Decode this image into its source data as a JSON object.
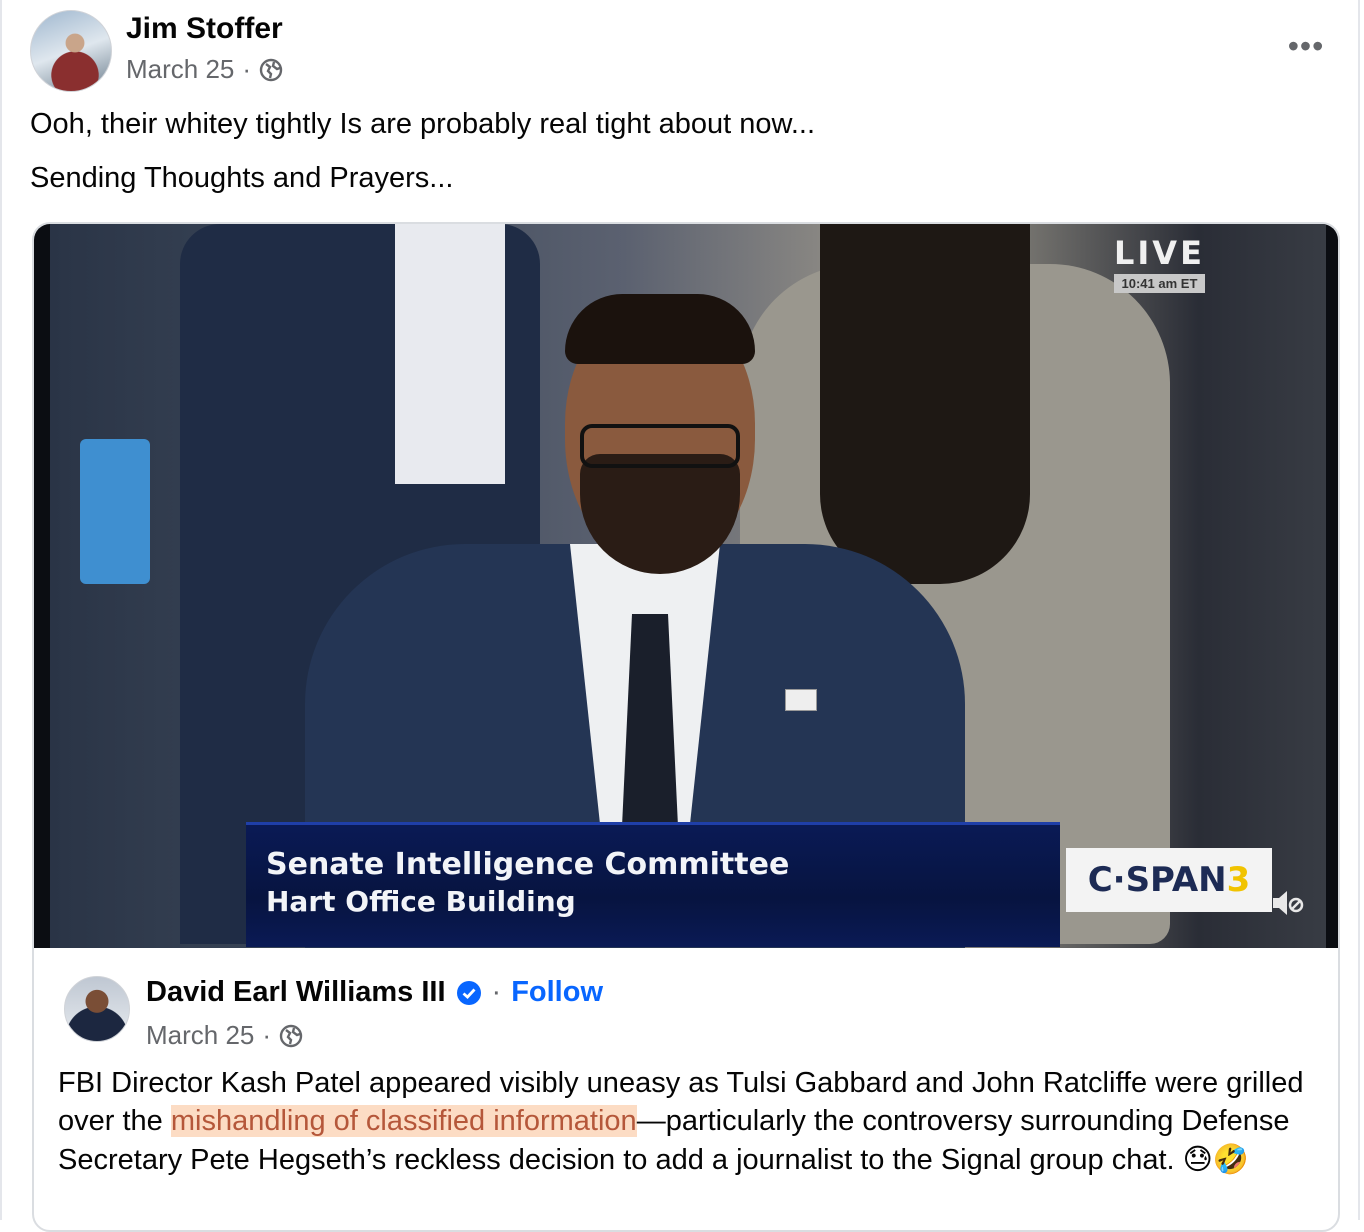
{
  "post": {
    "author": "Jim Stoffer",
    "date": "March 25",
    "separator": "·",
    "privacy_icon": "globe-icon",
    "more_icon": "more-horizontal-icon",
    "more_label": "•••",
    "text_line1": "Ooh, their whitey tightly Is are probably real tight about now...",
    "text_line2": "Sending Thoughts and Prayers..."
  },
  "video": {
    "live_label": "LIVE",
    "live_time": "10:41 am ET",
    "lower_third_line1": "Senate Intelligence Committee",
    "lower_third_line2": "Hart Office Building",
    "network_logo_main": "C·SPAN",
    "network_logo_num": "3",
    "mute_icon": "volume-muted-icon"
  },
  "shared": {
    "author": "David Earl Williams III",
    "verified_icon": "verified-badge-icon",
    "separator": "·",
    "follow_label": "Follow",
    "date": "March 25",
    "privacy_icon": "globe-icon",
    "text_before": "FBI Director Kash Patel appeared visibly uneasy as Tulsi Gabbard and John Ratcliffe were grilled over the ",
    "text_highlight": "mishandling of classified information",
    "text_after": "—particularly the controversy surrounding Defense Secretary Pete Hegseth’s reckless decision to add a journalist to the Signal group chat. ",
    "emojis": "😓🤣"
  },
  "colors": {
    "link": "#0866ff",
    "secondary_text": "#65676b",
    "highlight_bg": "#fcdcc4",
    "lower_third_bg": "#0a1a55"
  }
}
